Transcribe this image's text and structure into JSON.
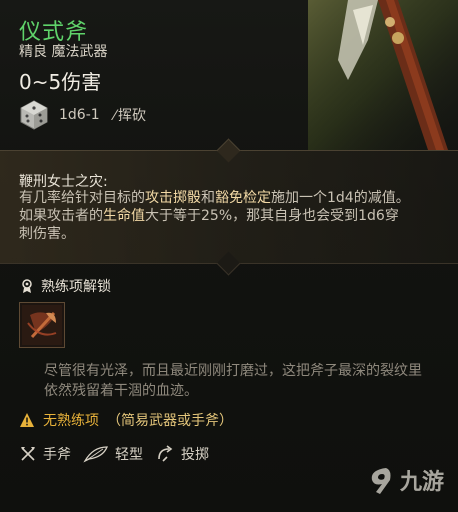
{
  "item": {
    "name": "仪式斧",
    "rarity_type": "精良 魔法武器",
    "damage": "0~5伤害",
    "dice": "1d6-1",
    "damage_type": "挥砍"
  },
  "passive": {
    "title": "鞭刑女士之灾:",
    "text_1": "有几率给针对目标的",
    "hl_1": "攻击掷骰",
    "text_2": "和",
    "hl_2": "豁免检定",
    "text_3": "施加一个1d4的减值。如果攻击者的",
    "hl_3": "生命值",
    "text_4": "大于等于25%，那其自身也会受到1d6穿刺伤害。"
  },
  "proficiency": {
    "header": "熟练项解锁",
    "flavor": "尽管很有光泽，而且最近刚刚打磨过，这把斧子最深的裂纹里依然残留着干涸的血迹。",
    "warning_label": "无熟练项",
    "warning_detail": "（简易武器或手斧）"
  },
  "tags": [
    {
      "label": "手斧",
      "icon": "axe-icon"
    },
    {
      "label": "轻型",
      "icon": "feather-icon"
    },
    {
      "label": "投掷",
      "icon": "throw-icon"
    }
  ],
  "watermark": "九游",
  "colors": {
    "name": "#5fd36a",
    "highlight": "#f2d9a6",
    "warning": "#e8b23a"
  }
}
